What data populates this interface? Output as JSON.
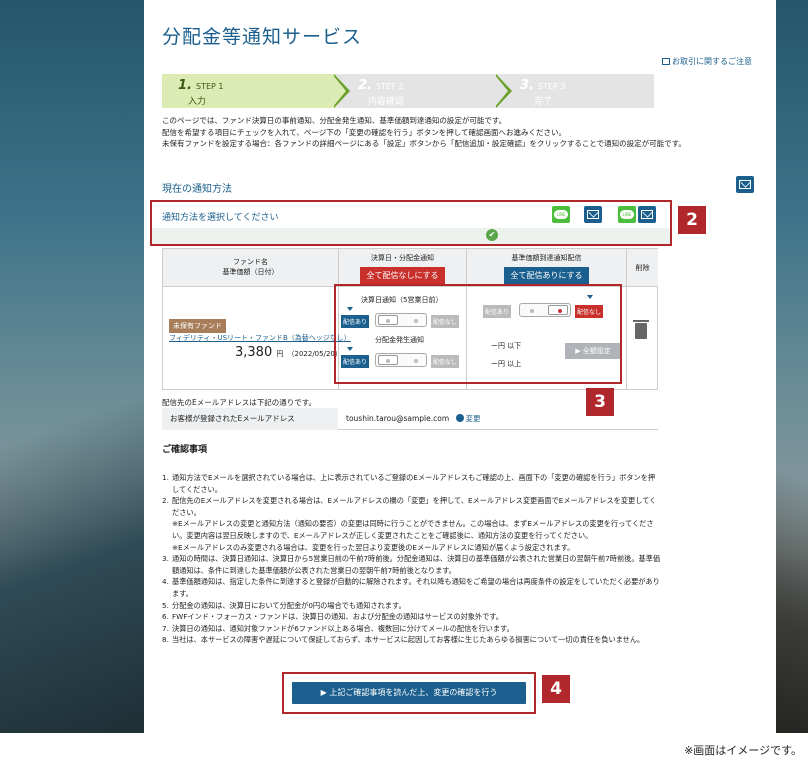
{
  "page": {
    "title": "分配金等通知サービス",
    "notice_link": "お取引に関するご注意"
  },
  "steps": [
    {
      "num": "1.",
      "label": "STEP 1",
      "sub": "入力"
    },
    {
      "num": "2.",
      "label": "STEP 2",
      "sub": "内容確認"
    },
    {
      "num": "3.",
      "label": "STEP 3",
      "sub": "完了"
    }
  ],
  "intro": [
    "このページでは、ファンド決算日の事前通知、分配金発生通知、基準価額到達通知の設定が可能です。",
    "配信を希望する項目にチェックを入れて、ページ下の「変更の確認を行う」ボタンを押して確認画面へお進みください。",
    "未保有ファンドを設定する場合：各ファンドの詳細ページにある「設定」ボタンから「配信追加・設定確認」をクリックすることで通知の設定が可能です。"
  ],
  "current_method": "現在の通知方法",
  "select_method": {
    "label": "通知方法を選択してください",
    "line_text": "LINE",
    "check": "✔"
  },
  "badges": {
    "b2": "2",
    "b3": "3",
    "b4": "4"
  },
  "table": {
    "fund_header": [
      "ファンド名",
      "基準価額（日付）"
    ],
    "settle_header": "決算日・分配金通知",
    "settle_all_off": "全て配信なしにする",
    "threshold_header": "基準価額到達通知配信",
    "threshold_all_on": "全て配信ありにする",
    "delete_header": "削除",
    "unowned": "未保有ファンド",
    "fund_name": "フィデリティ・USリート・ファンドB（為替ヘッジなし）",
    "price": "3,380",
    "price_unit": "円",
    "price_date": "（2022/05/20）",
    "settle_day_label": "決算日通知（5営業日前）",
    "dist_label": "分配金発生通知",
    "on": "配信あり",
    "off": "配信なし",
    "lower": "ー円 以下",
    "upper": "ー円 以上",
    "bulk_set": "▶ 全額設定"
  },
  "email": {
    "note": "配信先のEメールアドレスは下記の通りです。",
    "header": "お客様が登録されたEメールアドレス",
    "value": "toushin.tarou@sample.com",
    "change": "変更"
  },
  "confirm": {
    "title": "ご確認事項",
    "items": [
      {
        "n": "1.",
        "text": "通知方法でEメールを選択されている場合は、上に表示されているご登録のEメールアドレスもご確認の上、画面下の「変更の確認を行う」ボタンを押してください。"
      },
      {
        "n": "2.",
        "text": "配信先のEメールアドレスを変更される場合は、Eメールアドレスの欄の「変更」を押して、Eメールアドレス変更画面でEメールアドレスを変更してください。"
      },
      {
        "n": "",
        "text": "※Eメールアドレスの変更と通知方法（通知の要否）の変更は同時に行うことができません。この場合は、まずEメールアドレスの変更を行ってください。変更内容は翌日反映しますので、Eメールアドレスが正しく変更されたことをご確認後に、通知方法の変更を行ってください。"
      },
      {
        "n": "",
        "text": "※Eメールアドレスのみ変更される場合は、変更を行った翌日より変更後のEメールアドレスに通知が届くよう設定されます。"
      },
      {
        "n": "3.",
        "text": "通知の時間は、決算日通知は、決算日から5営業日前の午前7時前後。分配金通知は、決算日の基準価額が公表された営業日の翌朝午前7時前後。基準価額通知は、条件に到達した基準価額が公表された営業日の翌朝午前7時前後となります。"
      },
      {
        "n": "4.",
        "text": "基準価額通知は、指定した条件に到達すると登録が自動的に解除されます。それ以降も通知をご希望の場合は再度条件の設定をしていただく必要があります。"
      },
      {
        "n": "5.",
        "text": "分配金の通知は、決算日において分配金が0円の場合でも通知されます。"
      },
      {
        "n": "6.",
        "text": "FWFインド・フォーカス・ファンドは、決算日の通知、および分配金の通知はサービスの対象外です。"
      },
      {
        "n": "7.",
        "text": "決算日の通知は、通知対象ファンドが6ファンド以上ある場合、複数回に分けてメールの配信を行います。"
      },
      {
        "n": "8.",
        "text": "当社は、本サービスの障害や遅延について保証しておらず、本サービスに起因してお客様に生じたあらゆる損害について一切の責任を負いません。"
      }
    ],
    "button": "▶ 上記ご確認事項を読んだ上、変更の確認を行う"
  },
  "footnote": "※画面はイメージです。",
  "colors": {
    "brand": "#1b5f8e",
    "accent_red": "#b0282c",
    "step_active": "#dcebb3",
    "line_green": "#4bbf3d"
  }
}
